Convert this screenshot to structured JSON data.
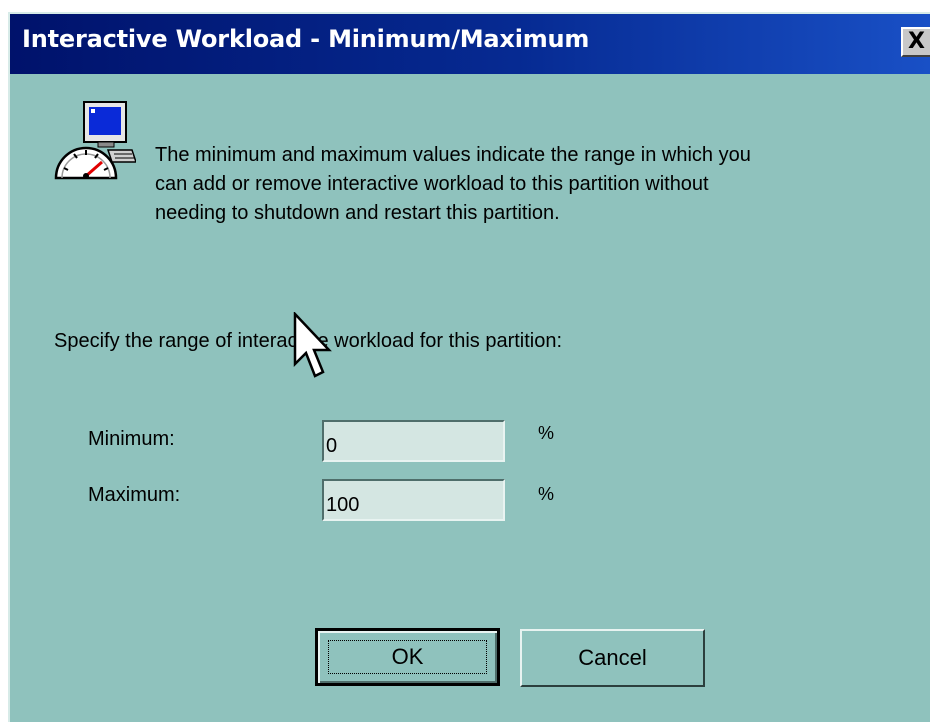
{
  "window": {
    "title": "Interactive Workload - Minimum/Maximum",
    "close_label": "X",
    "icon": "computer-gauge-icon"
  },
  "description": {
    "lines": [
      "The minimum and maximum values indicate the range in which you",
      "can add or remove interactive workload to this partition without",
      "needing to shutdown and restart this partition."
    ]
  },
  "prompt": "Specify the range of interactive workload for this partition:",
  "fields": {
    "minimum": {
      "label": "Minimum:",
      "value": "0",
      "unit": "%"
    },
    "maximum": {
      "label": "Maximum:",
      "value": "100",
      "unit": "%"
    }
  },
  "buttons": {
    "ok": "OK",
    "cancel": "Cancel"
  },
  "colors": {
    "background": "#8fc2bd",
    "titlebar": "#062a92",
    "field": "#d4e6e2"
  }
}
